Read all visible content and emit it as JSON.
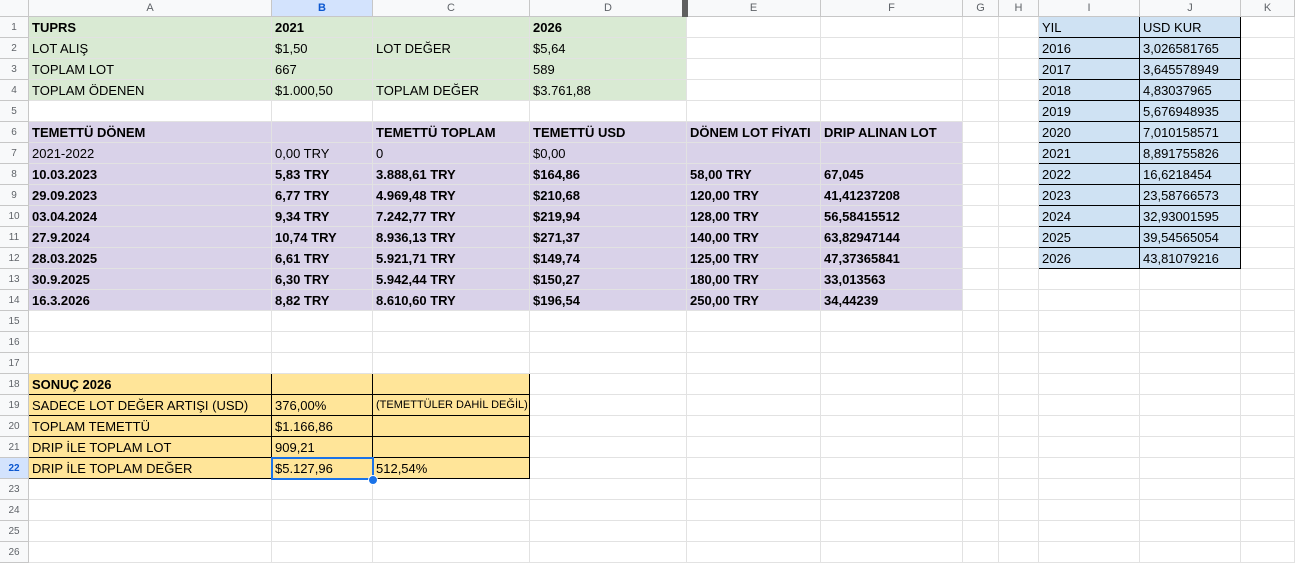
{
  "columns": [
    "A",
    "B",
    "C",
    "D",
    "E",
    "F",
    "G",
    "H",
    "I",
    "J",
    "K"
  ],
  "selected_col": "B",
  "selected_row": 22,
  "rows": [
    "1",
    "2",
    "3",
    "4",
    "5",
    "6",
    "7",
    "8",
    "9",
    "10",
    "11",
    "12",
    "13",
    "14",
    "15",
    "16",
    "17",
    "18",
    "19",
    "20",
    "21",
    "22",
    "23",
    "24",
    "25",
    "26"
  ],
  "summary": {
    "r1": [
      "TUPRS",
      "2021",
      "",
      "2026"
    ],
    "r2": [
      "LOT ALIŞ",
      "$1,50",
      "LOT DEĞER",
      "$5,64"
    ],
    "r3": [
      "TOPLAM LOT",
      "667",
      "",
      "589"
    ],
    "r4": [
      "TOPLAM ÖDENEN",
      "$1.000,50",
      "TOPLAM DEĞER",
      "$3.761,88"
    ]
  },
  "dividends": {
    "headers": [
      "TEMETTÜ DÖNEM",
      "",
      "TEMETTÜ TOPLAM",
      "TEMETTÜ USD",
      "DÖNEM LOT FİYATI",
      "DRIP ALINAN LOT"
    ],
    "rows": [
      [
        "2021-2022",
        "0,00 TRY",
        "0",
        "$0,00",
        "",
        ""
      ],
      [
        "10.03.2023",
        "5,83 TRY",
        "3.888,61 TRY",
        "$164,86",
        "58,00 TRY",
        "67,045"
      ],
      [
        "29.09.2023",
        "6,77 TRY",
        "4.969,48 TRY",
        "$210,68",
        "120,00 TRY",
        "41,41237208"
      ],
      [
        "03.04.2024",
        "9,34 TRY",
        "7.242,77 TRY",
        "$219,94",
        "128,00 TRY",
        "56,58415512"
      ],
      [
        "27.9.2024",
        "10,74 TRY",
        "8.936,13 TRY",
        "$271,37",
        "140,00 TRY",
        "63,82947144"
      ],
      [
        "28.03.2025",
        "6,61 TRY",
        "5.921,71 TRY",
        "$149,74",
        "125,00 TRY",
        "47,37365841"
      ],
      [
        "30.9.2025",
        "6,30 TRY",
        "5.942,44 TRY",
        "$150,27",
        "180,00 TRY",
        "33,013563"
      ],
      [
        "16.3.2026",
        "8,82 TRY",
        "8.610,60 TRY",
        "$196,54",
        "250,00 TRY",
        "34,44239"
      ]
    ]
  },
  "results": {
    "title": "SONUÇ 2026",
    "rows": [
      [
        "SADECE LOT DEĞER ARTIŞI (USD)",
        "376,00%",
        "(TEMETTÜLER DAHİL DEĞİL)"
      ],
      [
        "TOPLAM TEMETTÜ",
        "$1.166,86",
        ""
      ],
      [
        "DRIP İLE TOPLAM LOT",
        "909,21",
        ""
      ],
      [
        "DRIP İLE TOPLAM DEĞER",
        "$5.127,96",
        "512,54%"
      ]
    ]
  },
  "fx": {
    "headers": [
      "YIL",
      "USD KUR"
    ],
    "rows": [
      [
        "2016",
        "3,026581765"
      ],
      [
        "2017",
        "3,645578949"
      ],
      [
        "2018",
        "4,83037965"
      ],
      [
        "2019",
        "5,676948935"
      ],
      [
        "2020",
        "7,010158571"
      ],
      [
        "2021",
        "8,891755826"
      ],
      [
        "2022",
        "16,6218454"
      ],
      [
        "2023",
        "23,58766573"
      ],
      [
        "2024",
        "32,93001595"
      ],
      [
        "2025",
        "39,54565054"
      ],
      [
        "2026",
        "43,81079216"
      ]
    ]
  }
}
